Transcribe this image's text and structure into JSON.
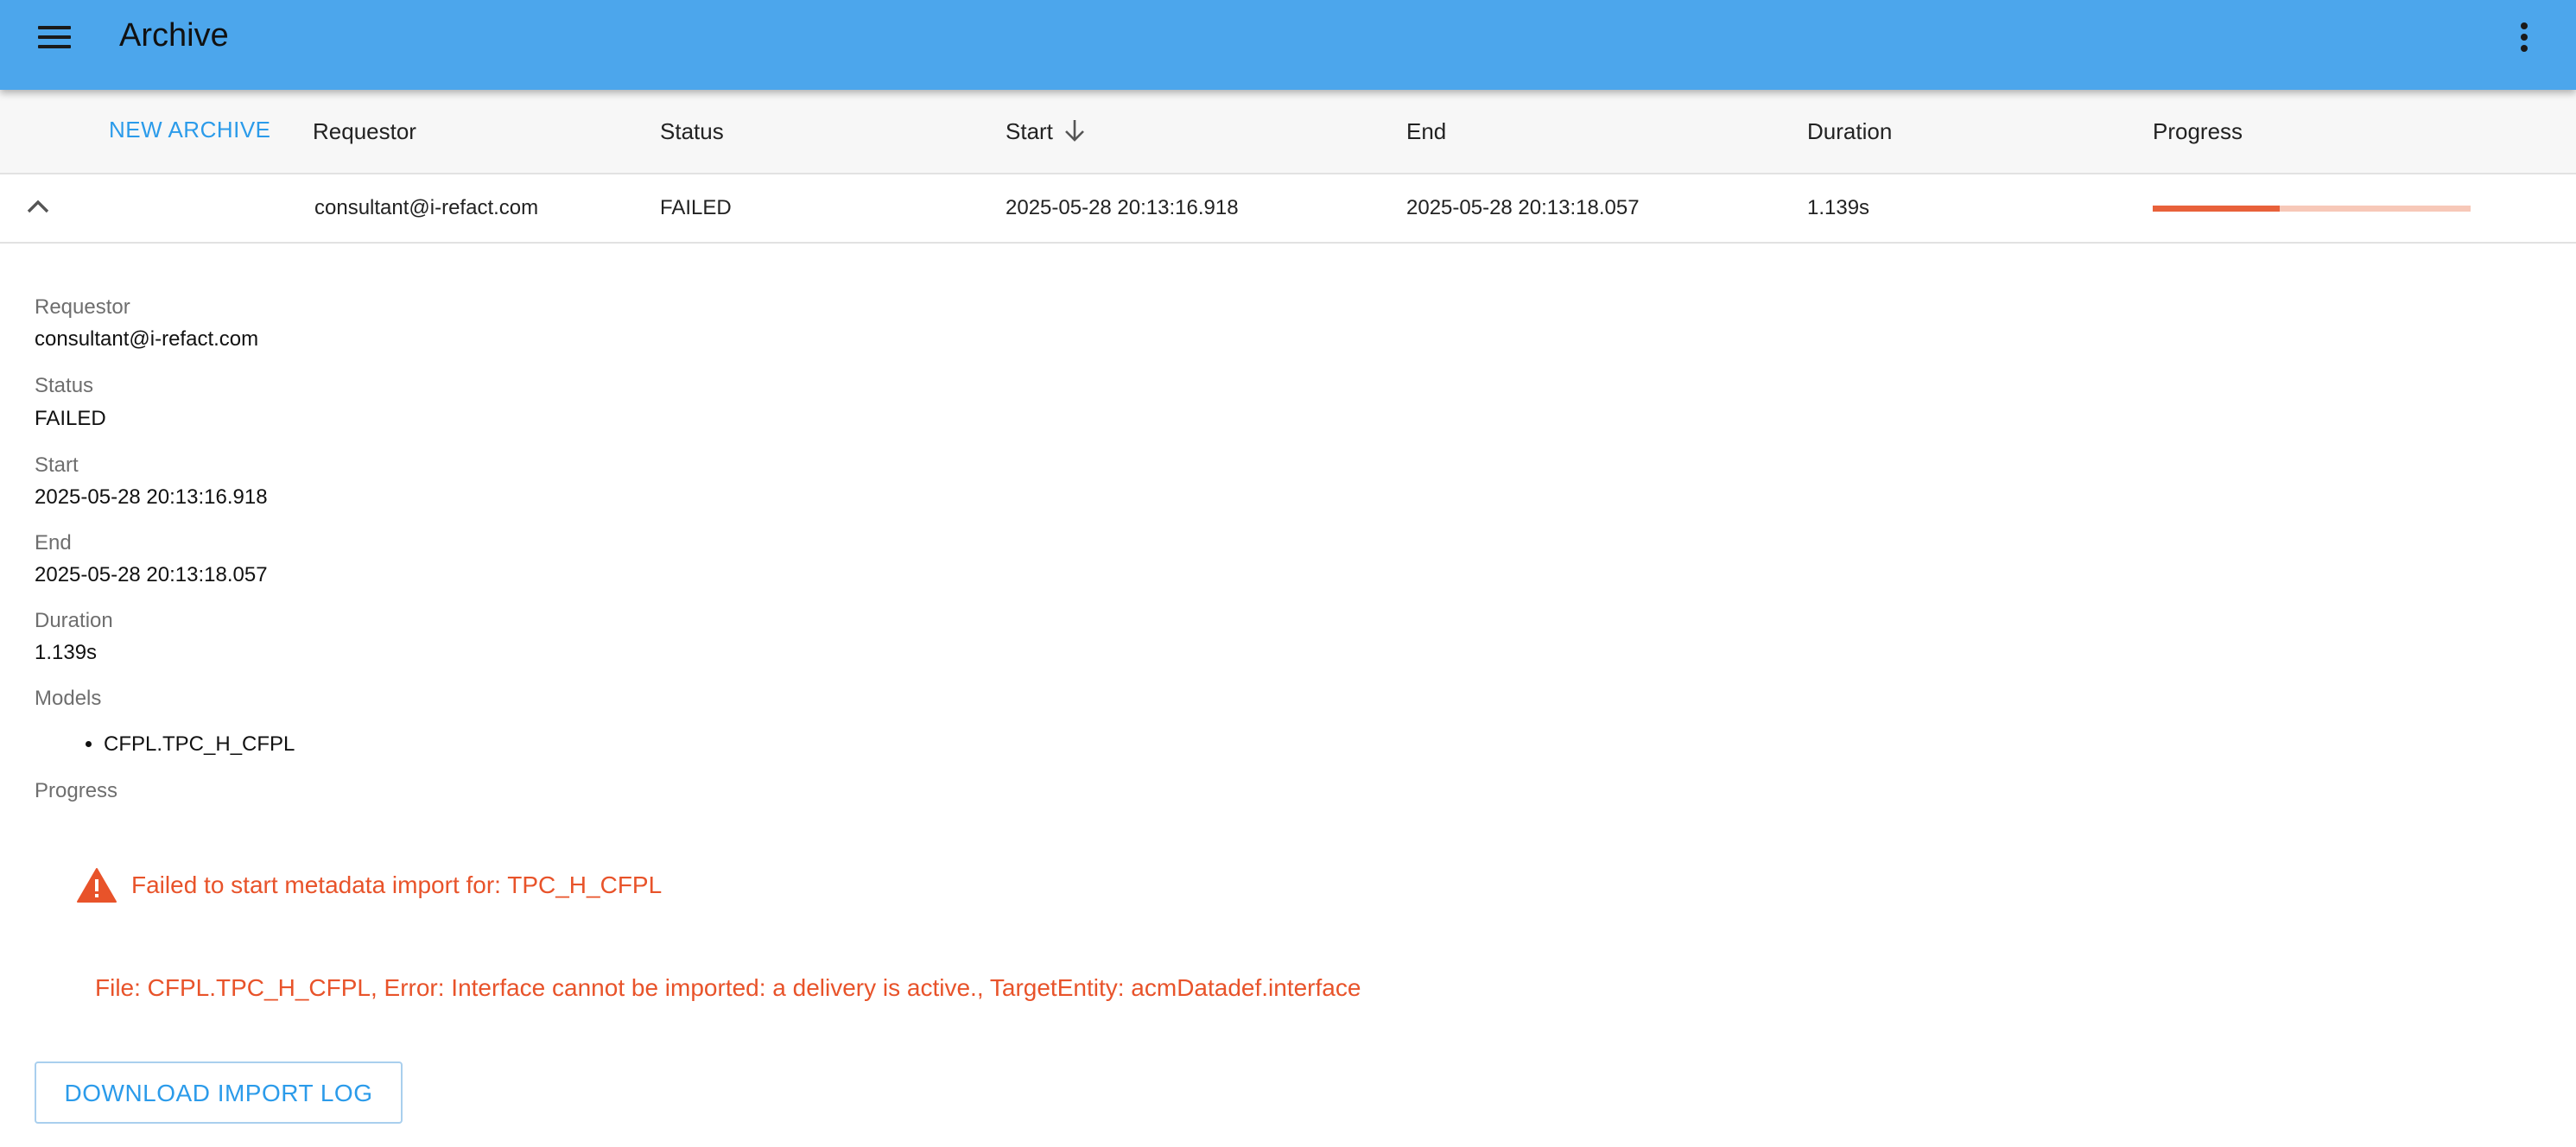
{
  "app": {
    "title": "Archive"
  },
  "toolbar": {
    "new_archive_label": "NEW ARCHIVE"
  },
  "table": {
    "columns": {
      "requestor": "Requestor",
      "status": "Status",
      "start": "Start",
      "end": "End",
      "duration": "Duration",
      "progress": "Progress"
    },
    "sort": {
      "column": "Start",
      "direction": "descending"
    },
    "rows": [
      {
        "requestor": "consultant@i-refact.com",
        "status": "FAILED",
        "start": "2025-05-28 20:13:16.918",
        "end": "2025-05-28 20:13:18.057",
        "duration": "1.139s",
        "progress_fraction": 0.4,
        "expanded": true
      }
    ]
  },
  "details": {
    "requestor_label": "Requestor",
    "requestor_value": "consultant@i-refact.com",
    "status_label": "Status",
    "status_value": "FAILED",
    "start_label": "Start",
    "start_value": "2025-05-28 20:13:16.918",
    "end_label": "End",
    "end_value": "2025-05-28 20:13:18.057",
    "duration_label": "Duration",
    "duration_value": "1.139s",
    "models_label": "Models",
    "models": [
      "CFPL.TPC_H_CFPL"
    ],
    "progress_label": "Progress",
    "error_title": "Failed to start metadata import for: TPC_H_CFPL",
    "error_detail": "File: CFPL.TPC_H_CFPL, Error: Interface cannot be imported: a delivery is active., TargetEntity: acmDatadef.interface",
    "download_label": "DOWNLOAD IMPORT LOG"
  },
  "icons": {
    "menu": "menu-icon",
    "more": "more-vert-icon",
    "sort": "arrow-down-icon",
    "collapse": "chevron-up-icon",
    "warning": "warning-icon"
  },
  "colors": {
    "app_bar": "#4ca6ec",
    "accent": "#2b9bea",
    "error": "#e8532a",
    "progress_fill": "#e8613a",
    "progress_track": "#f7c8b8"
  }
}
